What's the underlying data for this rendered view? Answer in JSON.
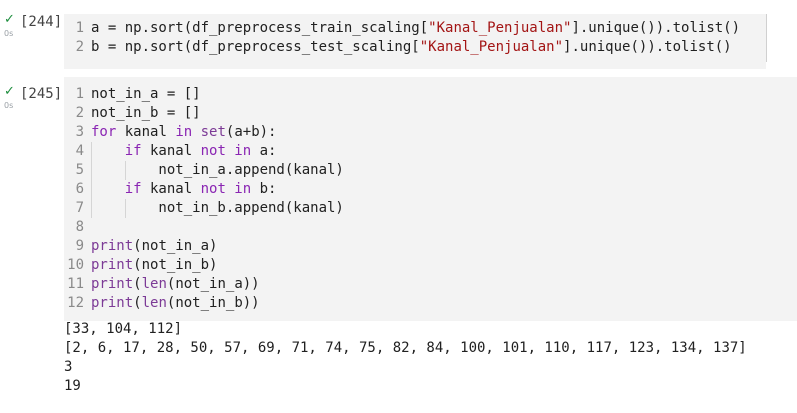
{
  "cells": [
    {
      "exec_count": "[244]",
      "duration": "0s",
      "lines": [
        [
          {
            "t": "a = np.sort(df_preprocess_train_scaling["
          },
          {
            "t": "\"Kanal_Penjualan\"",
            "c": "str"
          },
          {
            "t": "].unique()).tolist()"
          }
        ],
        [
          {
            "t": "b = np.sort(df_preprocess_test_scaling["
          },
          {
            "t": "\"Kanal_Penjualan\"",
            "c": "str"
          },
          {
            "t": "].unique()).tolist()"
          }
        ]
      ]
    },
    {
      "exec_count": "[245]",
      "duration": "0s",
      "lines": [
        [
          {
            "t": "not_in_a = []"
          }
        ],
        [
          {
            "t": "not_in_b = []"
          }
        ],
        [
          {
            "t": "for",
            "c": "kw"
          },
          {
            "t": " kanal "
          },
          {
            "t": "in",
            "c": "kw"
          },
          {
            "t": " "
          },
          {
            "t": "set",
            "c": "bi"
          },
          {
            "t": "(a+b):"
          }
        ],
        [
          {
            "t": "    "
          },
          {
            "t": "if",
            "c": "kw"
          },
          {
            "t": " kanal "
          },
          {
            "t": "not in",
            "c": "kw"
          },
          {
            "t": " a:"
          }
        ],
        [
          {
            "t": "        not_in_a.append(kanal)"
          }
        ],
        [
          {
            "t": "    "
          },
          {
            "t": "if",
            "c": "kw"
          },
          {
            "t": " kanal "
          },
          {
            "t": "not in",
            "c": "kw"
          },
          {
            "t": " b:"
          }
        ],
        [
          {
            "t": "        not_in_b.append(kanal)"
          }
        ],
        [
          {
            "t": ""
          }
        ],
        [
          {
            "t": "print",
            "c": "bi"
          },
          {
            "t": "(not_in_a)"
          }
        ],
        [
          {
            "t": "print",
            "c": "bi"
          },
          {
            "t": "(not_in_b)"
          }
        ],
        [
          {
            "t": "print",
            "c": "bi"
          },
          {
            "t": "("
          },
          {
            "t": "len",
            "c": "bi"
          },
          {
            "t": "(not_in_a))"
          }
        ],
        [
          {
            "t": "print",
            "c": "bi"
          },
          {
            "t": "("
          },
          {
            "t": "len",
            "c": "bi"
          },
          {
            "t": "(not_in_b))"
          }
        ]
      ],
      "output": [
        "[33, 104, 112]",
        "[2, 6, 17, 28, 50, 57, 69, 71, 74, 75, 82, 84, 100, 101, 110, 117, 123, 134, 137]",
        "3",
        "19"
      ]
    }
  ],
  "icons": {
    "status": "check-icon"
  },
  "colors": {
    "check": "#1e8e3e",
    "keyword": "#8a25b3",
    "string": "#a31515",
    "editor_bg": "#f3f3f3"
  }
}
